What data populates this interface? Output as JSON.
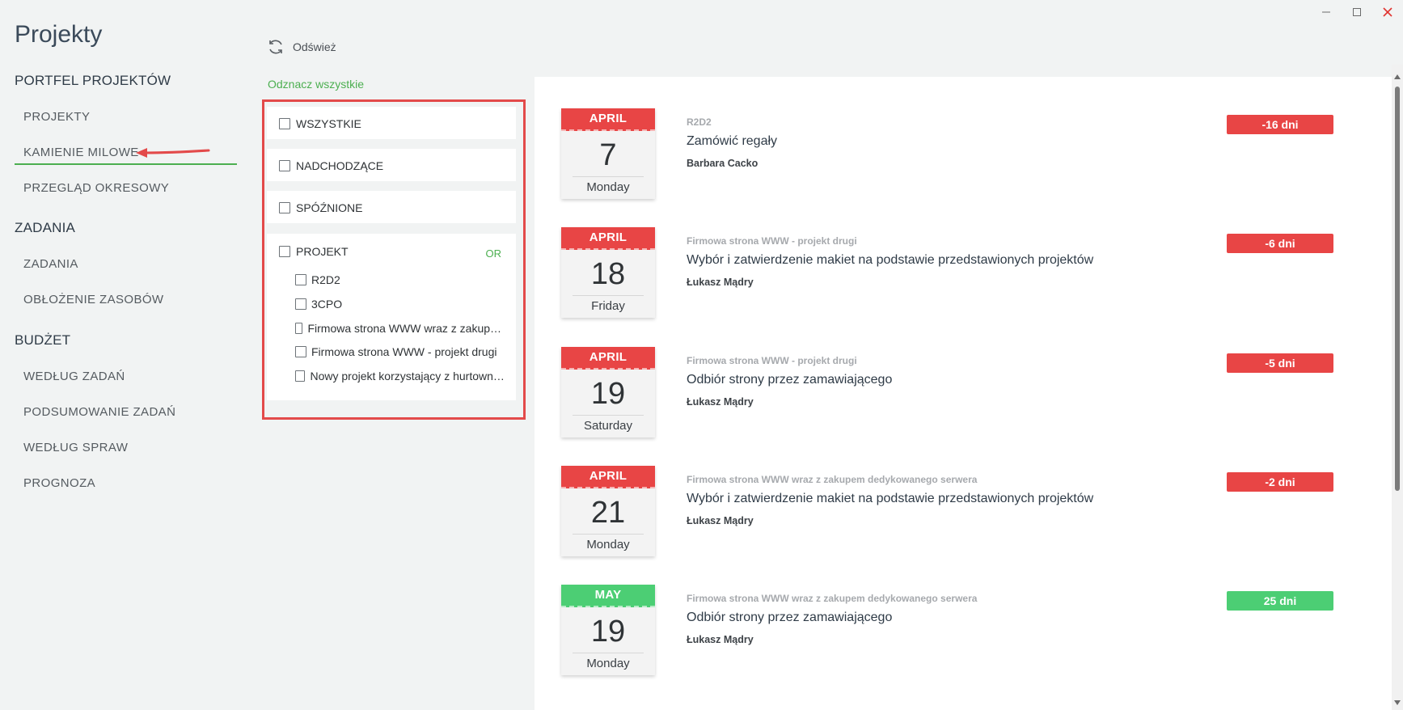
{
  "app": {
    "title": "Projekty"
  },
  "colors": {
    "red": "#e84545",
    "green": "#4cce74",
    "accent_green": "#4caf50",
    "annotation_red": "#e34a4a"
  },
  "sidebar": {
    "sections": [
      {
        "title": "PORTFEL PROJEKTÓW",
        "items": [
          "PROJEKTY",
          "KAMIENIE MILOWE",
          "PRZEGLĄD OKRESOWY"
        ]
      },
      {
        "title": "ZADANIA",
        "items": [
          "ZADANIA",
          "OBŁOŻENIE ZASOBÓW"
        ]
      },
      {
        "title": "BUDŻET",
        "items": [
          "WEDŁUG ZADAŃ",
          "PODSUMOWANIE ZADAŃ",
          "WEDŁUG SPRAW",
          "PROGNOZA"
        ]
      }
    ],
    "active_item": "KAMIENIE MILOWE"
  },
  "toolbar": {
    "refresh_label": "Odśwież",
    "refresh_icon": "refresh-icon"
  },
  "filters": {
    "uncheck_all_label": "Odznacz wszystkie",
    "status": [
      "WSZYSTKIE",
      "NADCHODZĄCE",
      "SPÓŹNIONE"
    ],
    "project_label": "PROJEKT",
    "operator": "OR",
    "projects": [
      "R2D2",
      "3CPO",
      "Firmowa strona WWW wraz z zakupem dedykowanego serwera",
      "Firmowa strona WWW - projekt drugi",
      "Nowy projekt korzystający z hurtowni danych"
    ]
  },
  "milestones": [
    {
      "month": "APRIL",
      "day": "7",
      "weekday": "Monday",
      "project": "R2D2",
      "title": "Zamówić regały",
      "person": "Barbara Cacko",
      "badge": "-16 dni",
      "status": "late"
    },
    {
      "month": "APRIL",
      "day": "18",
      "weekday": "Friday",
      "project": "Firmowa strona WWW - projekt drugi",
      "title": "Wybór i zatwierdzenie makiet na podstawie przedstawionych projektów",
      "person": "Łukasz Mądry",
      "badge": "-6 dni",
      "status": "late"
    },
    {
      "month": "APRIL",
      "day": "19",
      "weekday": "Saturday",
      "project": "Firmowa strona WWW - projekt drugi",
      "title": "Odbiór strony przez zamawiającego",
      "person": "Łukasz Mądry",
      "badge": "-5 dni",
      "status": "late"
    },
    {
      "month": "APRIL",
      "day": "21",
      "weekday": "Monday",
      "project": "Firmowa strona WWW wraz z zakupem dedykowanego serwera",
      "title": "Wybór i zatwierdzenie makiet na podstawie przedstawionych projektów",
      "person": "Łukasz Mądry",
      "badge": "-2 dni",
      "status": "late"
    },
    {
      "month": "MAY",
      "day": "19",
      "weekday": "Monday",
      "project": "Firmowa strona WWW wraz z zakupem dedykowanego serwera",
      "title": "Odbiór strony przez zamawiającego",
      "person": "Łukasz Mądry",
      "badge": "25 dni",
      "status": "upcoming"
    }
  ]
}
